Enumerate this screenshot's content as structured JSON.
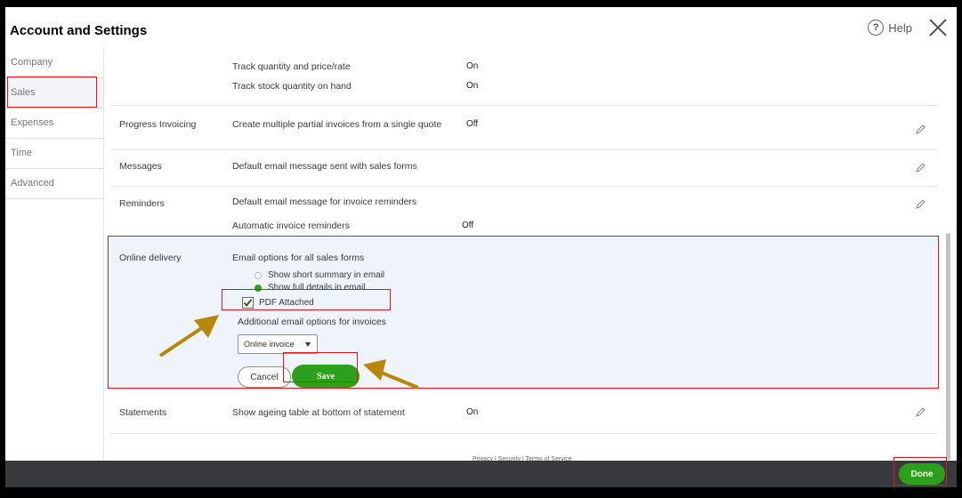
{
  "header": {
    "title": "Account and Settings",
    "help_label": "Help",
    "help_glyph": "?"
  },
  "sidebar": {
    "items": [
      {
        "label": "Company"
      },
      {
        "label": "Sales"
      },
      {
        "label": "Expenses"
      },
      {
        "label": "Time"
      },
      {
        "label": "Advanced"
      }
    ],
    "active": "Sales"
  },
  "settings": {
    "track_qty_label": "Track quantity and price/rate",
    "track_qty_value": "On",
    "track_stock_label": "Track stock quantity on hand",
    "track_stock_value": "On",
    "progress": {
      "section": "Progress Invoicing",
      "label": "Create multiple partial invoices from a single quote",
      "value": "Off"
    },
    "messages": {
      "section": "Messages",
      "label": "Default email message sent with sales forms"
    },
    "reminders": {
      "section": "Reminders",
      "label": "Default email message for invoice reminders",
      "auto_label": "Automatic invoice reminders",
      "auto_value": "Off"
    },
    "online_delivery": {
      "section": "Online delivery",
      "email_options_label": "Email options for all sales forms",
      "radio_summary": "Show short summary in email",
      "radio_full": "Show full details in email",
      "selected_radio": "Show full details in email",
      "pdf_label": "PDF Attached",
      "pdf_checked": true,
      "additional_label": "Additional email options for invoices",
      "select_value": "Online invoice",
      "cancel_label": "Cancel",
      "save_label": "Save"
    },
    "statements": {
      "section": "Statements",
      "label": "Show ageing table at bottom of statement",
      "value": "On"
    }
  },
  "footer": {
    "links": "Privacy  |  Security  |  Terms of Service"
  },
  "done_label": "Done",
  "colors": {
    "accent_green": "#2ca01c",
    "highlight_red": "#e8141c",
    "arrow_gold": "#b8860b",
    "bottom_bar": "#393a3d"
  }
}
